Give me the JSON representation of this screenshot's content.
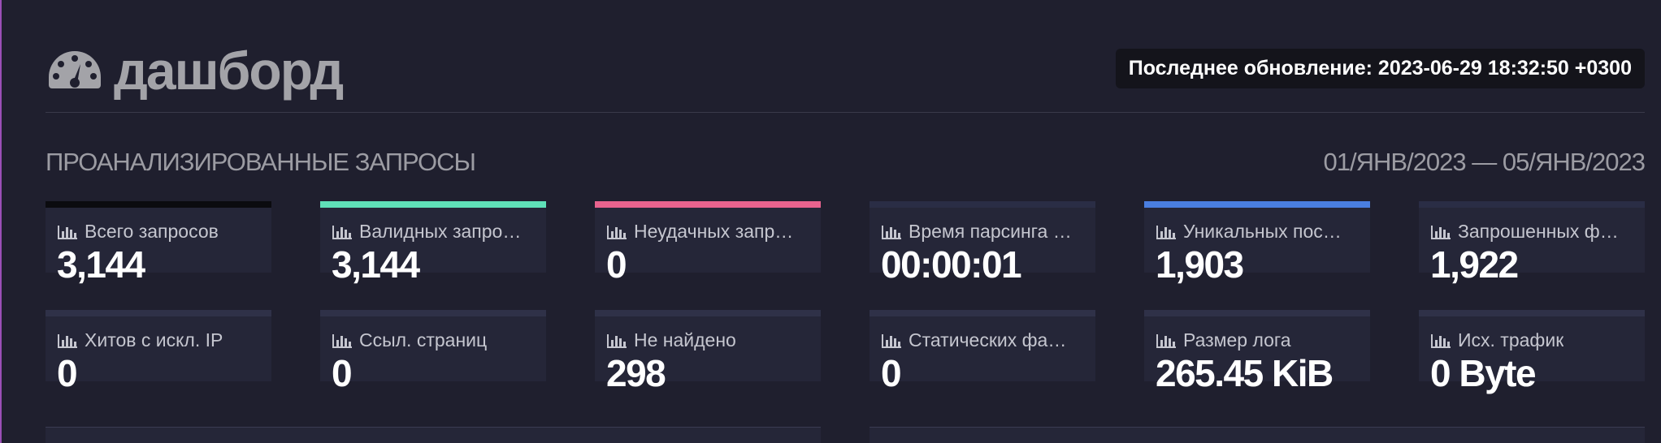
{
  "header": {
    "title": "дашборд",
    "icon": "dashboard-gauge-icon",
    "last_update": "Последнее обновление: 2023-06-29 18:32:50 +0300"
  },
  "section": {
    "title": "ПРОАНАЛИЗИРОВАННЫЕ ЗАПРОСЫ",
    "date_range": "01/ЯНВ/2023 — 05/ЯНВ/2023"
  },
  "colors": {
    "background": "#1f1f2e",
    "card": "#252638",
    "accent_total": "#0b0b0f",
    "accent_valid": "#5fe0b8",
    "accent_failed": "#e8638e",
    "accent_time": "#2a2d45",
    "accent_unique": "#4a7ee0",
    "accent_files": "#2a2d45",
    "accent_row2": "#2f3148",
    "left_edge": "#9a4fb6"
  },
  "cards_row1": [
    {
      "label": "Всего запросов",
      "value": "3,144",
      "icon": "bar-chart-icon"
    },
    {
      "label": "Валидных запро…",
      "value": "3,144",
      "icon": "bar-chart-icon"
    },
    {
      "label": "Неудачных запр…",
      "value": "0",
      "icon": "bar-chart-icon"
    },
    {
      "label": "Время парсинга …",
      "value": "00:00:01",
      "icon": "bar-chart-icon"
    },
    {
      "label": "Уникальных пос…",
      "value": "1,903",
      "icon": "bar-chart-icon"
    },
    {
      "label": "Запрошенных ф…",
      "value": "1,922",
      "icon": "bar-chart-icon"
    }
  ],
  "cards_row2": [
    {
      "label": "Хитов с искл. IP",
      "value": "0",
      "icon": "bar-chart-icon"
    },
    {
      "label": "Ссыл. страниц",
      "value": "0",
      "icon": "bar-chart-icon"
    },
    {
      "label": "Не найдено",
      "value": "298",
      "icon": "bar-chart-icon"
    },
    {
      "label": "Статических фа…",
      "value": "0",
      "icon": "bar-chart-icon"
    },
    {
      "label": "Размер лога",
      "value": "265.45 KiB",
      "icon": "bar-chart-icon"
    },
    {
      "label": "Исх. трафик",
      "value": "0 Byte",
      "icon": "bar-chart-icon"
    }
  ]
}
